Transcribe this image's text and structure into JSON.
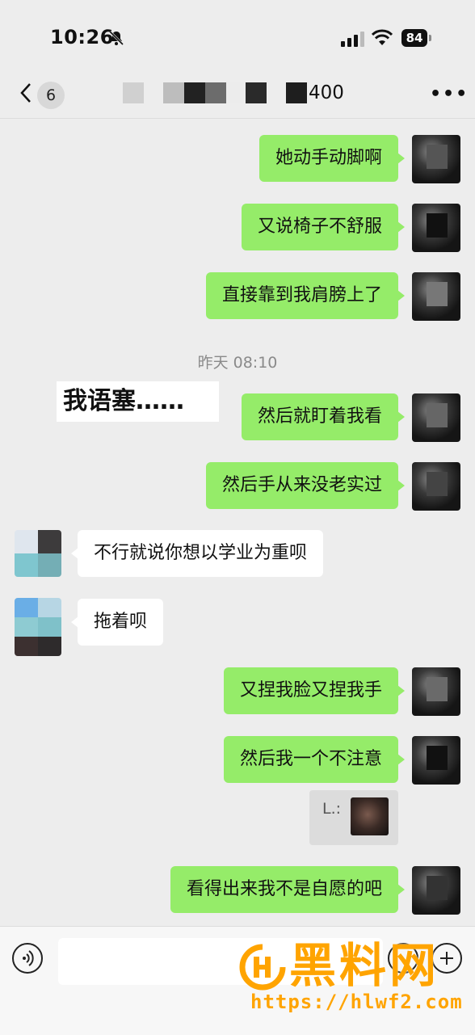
{
  "status_bar": {
    "time": "10:26",
    "battery": "84"
  },
  "header": {
    "unread_count": "6",
    "title_visible": "400"
  },
  "messages_right_1": [
    "她动手动脚啊",
    "又说椅子不舒服",
    "直接靠到我肩膀上了"
  ],
  "timestamp": "昨天 08:10",
  "caption": "我语塞……",
  "messages_right_2": [
    "然后就盯着我看",
    "然后手从来没老实过"
  ],
  "messages_left": [
    "不行就说你想以学业为重呗",
    "拖着呗"
  ],
  "messages_right_3": [
    "又捏我脸又捏我手",
    "然后我一个不注意"
  ],
  "quote": {
    "label": "L.:"
  },
  "messages_right_4": [
    "看得出来我不是自愿的吧"
  ],
  "watermark": {
    "title": "黑料网",
    "url": "https://hlwf2.com"
  },
  "colors": {
    "bubble_green": "#95ec69",
    "background": "#ededed",
    "watermark": "#ffa400"
  }
}
